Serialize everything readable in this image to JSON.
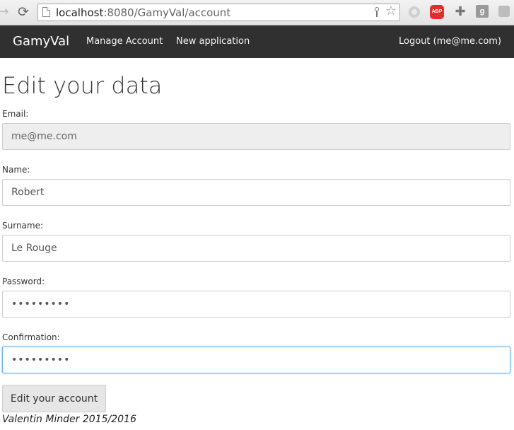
{
  "browser": {
    "url_host": "localhost",
    "url_rest": ":8080/GamyVal/account"
  },
  "navbar": {
    "brand": "GamyVal",
    "manage_account": "Manage Account",
    "new_application": "New application",
    "logout": "Logout (me@me.com)"
  },
  "page": {
    "title": "Edit your data"
  },
  "form": {
    "email": {
      "label": "Email:",
      "value": "me@me.com",
      "readonly": true
    },
    "name": {
      "label": "Name:",
      "value": "Robert"
    },
    "surname": {
      "label": "Surname:",
      "value": "Le Rouge"
    },
    "password": {
      "label": "Password:",
      "value": "•••••••••"
    },
    "confirmation": {
      "label": "Confirmation:",
      "value": "•••••••••",
      "focused": true
    },
    "submit_label": "Edit your account"
  },
  "footer": {
    "text": "Valentin Minder 2015/2016"
  },
  "colors": {
    "navbar_bg": "#303030",
    "focus_border": "#66afe9",
    "readonly_bg": "#eeeeee"
  }
}
